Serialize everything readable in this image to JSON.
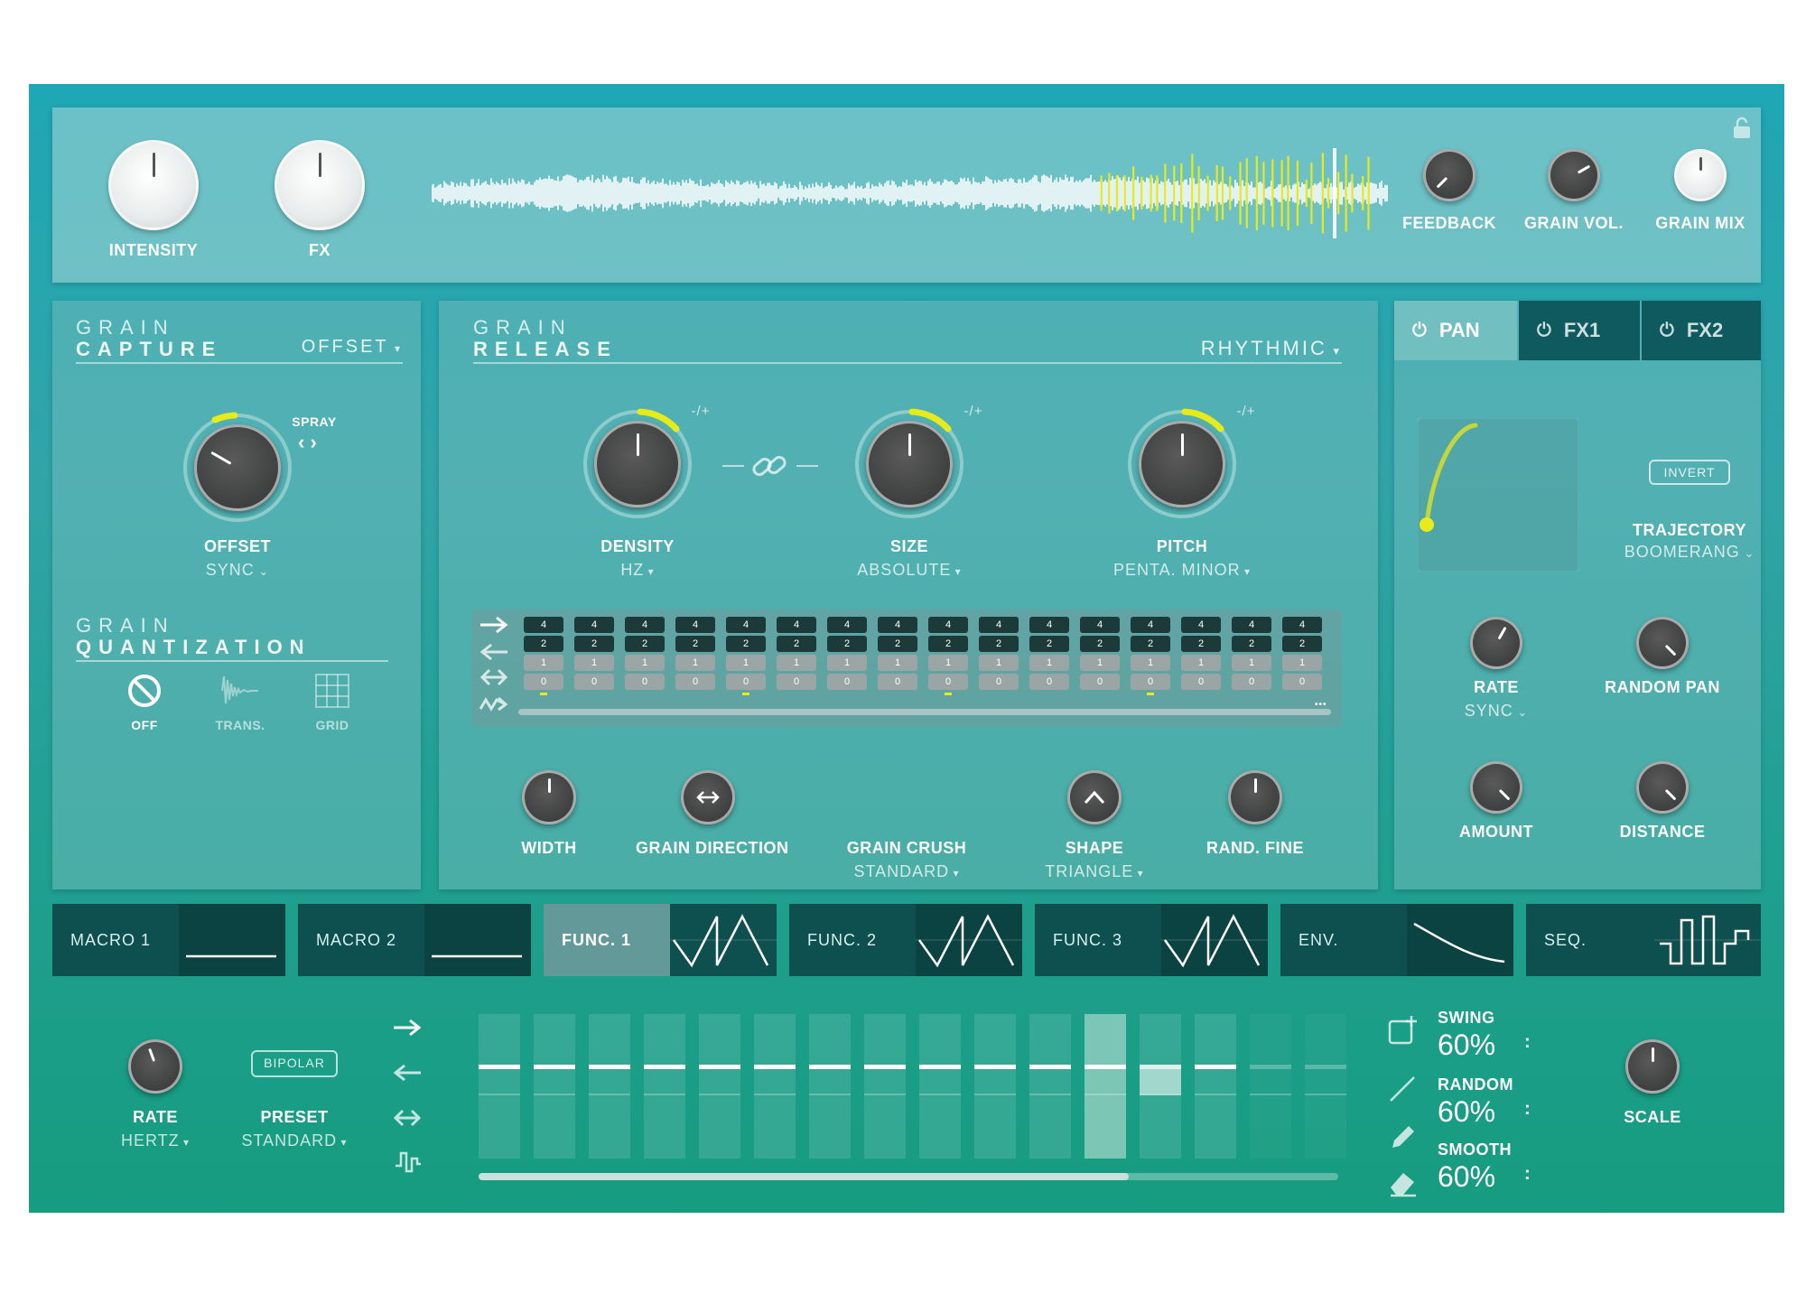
{
  "top": {
    "knobs": [
      {
        "label": "INTENSITY"
      },
      {
        "label": "FX"
      }
    ],
    "right_knobs": [
      {
        "label": "FEEDBACK"
      },
      {
        "label": "GRAIN VOL."
      },
      {
        "label": "GRAIN MIX"
      }
    ],
    "lock_icon": "lock-open-icon"
  },
  "capture": {
    "title_line1": "GRAIN",
    "title_line2": "CAPTURE",
    "mode": "OFFSET",
    "spray_label": "SPRAY",
    "knob_label": "OFFSET",
    "knob_sub": "SYNC"
  },
  "quantization": {
    "title_line1": "GRAIN",
    "title_line2": "QUANTIZATION",
    "options": [
      {
        "label": "OFF",
        "icon": "off-icon"
      },
      {
        "label": "TRANS.",
        "icon": "transient-icon"
      },
      {
        "label": "GRID",
        "icon": "grid-icon"
      }
    ]
  },
  "release": {
    "title_line1": "GRAIN",
    "title_line2": "RELEASE",
    "mode": "RHYTHMIC",
    "plusminus": "-/+",
    "knobs": [
      {
        "label": "DENSITY",
        "sub": "HZ"
      },
      {
        "label": "SIZE",
        "sub": "ABSOLUTE"
      },
      {
        "label": "PITCH",
        "sub": "PENTA. MINOR"
      }
    ],
    "step_values": [
      "4",
      "2",
      "1",
      "0"
    ],
    "more": "•••",
    "bottom": [
      {
        "label": "WIDTH",
        "sub": ""
      },
      {
        "label": "GRAIN DIRECTION",
        "sub": ""
      },
      {
        "label": "GRAIN CRUSH",
        "sub": "STANDARD"
      },
      {
        "label": "SHAPE",
        "sub": "TRIANGLE"
      },
      {
        "label": "RAND. FINE",
        "sub": ""
      }
    ]
  },
  "pan": {
    "tabs": [
      {
        "label": "PAN"
      },
      {
        "label": "FX1"
      },
      {
        "label": "FX2"
      }
    ],
    "invert": "INVERT",
    "trajectory_label": "TRAJECTORY",
    "trajectory_value": "BOOMERANG",
    "knobs": [
      {
        "label": "RATE",
        "sub": "SYNC"
      },
      {
        "label": "RANDOM PAN",
        "sub": ""
      },
      {
        "label": "AMOUNT",
        "sub": ""
      },
      {
        "label": "DISTANCE",
        "sub": ""
      }
    ]
  },
  "mod_tabs": [
    {
      "label": "MACRO 1",
      "active": false
    },
    {
      "label": "MACRO 2",
      "active": false
    },
    {
      "label": "FUNC. 1",
      "active": true
    },
    {
      "label": "FUNC. 2",
      "active": false
    },
    {
      "label": "FUNC. 3",
      "active": false
    },
    {
      "label": "ENV.",
      "active": false
    },
    {
      "label": "SEQ.",
      "active": false
    }
  ],
  "sequencer": {
    "rate_label": "RATE",
    "rate_sub": "HERTZ",
    "bipolar": "BIPOLAR",
    "preset_label": "PRESET",
    "preset_sub": "STANDARD",
    "swing_label": "SWING",
    "swing_value": "60%",
    "random_label": "RANDOM",
    "random_value": "60%",
    "smooth_label": "SMOOTH",
    "smooth_value": "60%",
    "scale_label": "SCALE",
    "colon": ":"
  },
  "colors": {
    "accent": "#e8ea1a",
    "knob_dark": "#3f4040",
    "teal_dark": "#0e4f4f"
  }
}
